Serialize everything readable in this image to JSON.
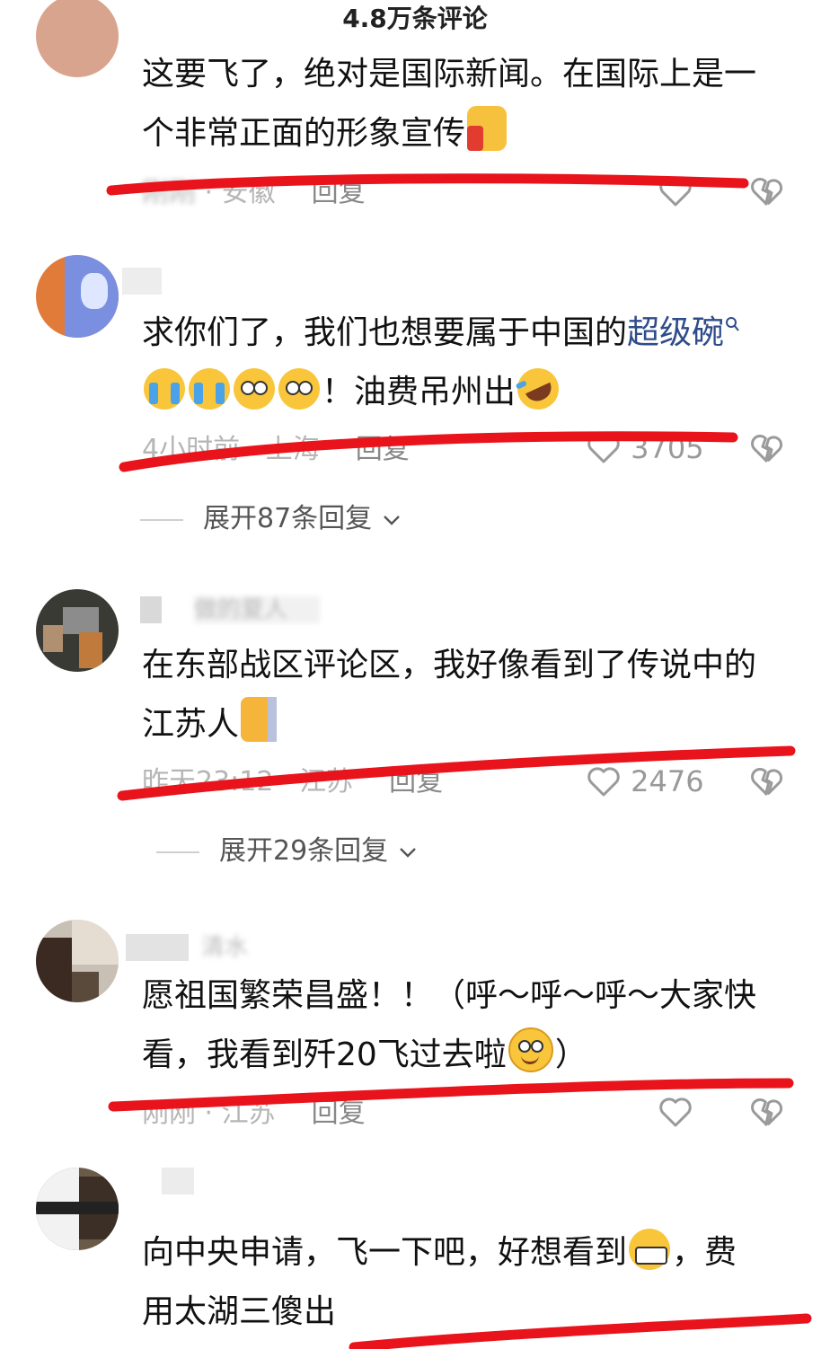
{
  "header": {
    "title": "4.8万条评论"
  },
  "comments": [
    {
      "text_lines": [
        "这要飞了，绝对是国际新闻。在国际上是一",
        "个非常正面的形象宣传"
      ],
      "meta": {
        "time": "刚刚",
        "location": "安徽",
        "reply": "回复"
      },
      "likes": ""
    },
    {
      "text_line1_pre": "求你们了，我们也想要属于中国的",
      "text_link": "超级碗",
      "text_line2": "！油费吊州出",
      "meta": {
        "time": "4小时前",
        "location": "上海",
        "reply": "回复"
      },
      "likes": "3705",
      "expand": "展开87条回复"
    },
    {
      "username": "做的夏人",
      "text_lines": [
        "在东部战区评论区，我好像看到了传说中的",
        "江苏人"
      ],
      "meta": {
        "time": "昨天23:12 · 江苏",
        "reply": "回复"
      },
      "likes": "2476",
      "expand": "展开29条回复"
    },
    {
      "username": "清水",
      "text_lines": [
        "愿祖国繁荣昌盛！！（呼～呼～呼～大家快",
        "看，我看到歼20飞过去啦"
      ],
      "text_tail": "）",
      "meta": {
        "time": "刚刚 · 江苏",
        "reply": "回复"
      },
      "likes": ""
    },
    {
      "text_line1_pre": "向中央申请，飞一下吧，好想看到",
      "text_line1_post": "，费",
      "text_line2": "用太湖三傻出"
    }
  ],
  "colors": {
    "annotation_red": "#e8131b",
    "link": "#2f4c8a",
    "meta_gray": "#b5b5b5"
  },
  "icons": [
    "heart-outline-icon",
    "broken-heart-icon",
    "chevron-down-icon",
    "search-icon",
    "thumbs-up-emoji",
    "crying-emoji",
    "pleading-emoji",
    "rofl-emoji",
    "cat-emoji",
    "smile-emoji",
    "grin-emoji"
  ]
}
